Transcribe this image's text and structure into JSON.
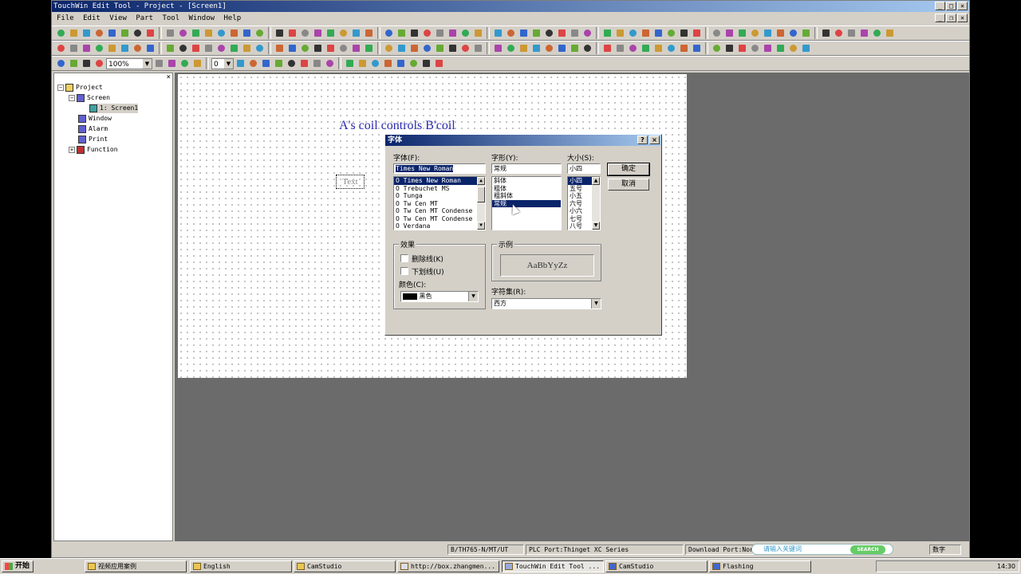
{
  "window": {
    "title": "TouchWin Edit Tool - Project - [Screen1]",
    "min": "_",
    "max": "□",
    "close": "×",
    "restore": "❐"
  },
  "menu": [
    "File",
    "Edit",
    "View",
    "Part",
    "Tool",
    "Window",
    "Help"
  ],
  "toolbar": {
    "zoom": "100%",
    "step": "0"
  },
  "tree": {
    "close": "×",
    "expand": "−",
    "collapse": "+",
    "project": "Project",
    "screen": "Screen",
    "screen1": "1: Screen1",
    "window": "Window",
    "alarm": "Alarm",
    "print": "Print",
    "function": "Function"
  },
  "canvas": {
    "title_text": "A's coil controls B'coil",
    "text_object": "Text"
  },
  "font_dialog": {
    "title": "字体",
    "help": "?",
    "close": "×",
    "font_label": "字体(F):",
    "font_value": "Times New Roman",
    "fonts": [
      "Times New Roman",
      "Trebuchet MS",
      "Tunga",
      "Tw Cen MT",
      "Tw Cen MT Condense",
      "Tw Cen MT Condense",
      "Verdana"
    ],
    "style_label": "字形(Y):",
    "style_value": "常规",
    "styles": [
      "常规",
      "斜体",
      "粗体",
      "粗斜体"
    ],
    "size_label": "大小(S):",
    "size_value": "小四",
    "sizes": [
      "小四",
      "五号",
      "小五",
      "六号",
      "小六",
      "七号",
      "八号"
    ],
    "ok": "确定",
    "cancel": "取消",
    "effects_label": "效果",
    "strikeout": "删除线(K)",
    "underline": "下划线(U)",
    "color_label": "颜色(C):",
    "color_value": "黑色",
    "sample_label": "示例",
    "sample_text": "AaBbYyZz",
    "charset_label": "字符集(R):",
    "charset_value": "西方"
  },
  "statusbar": {
    "model": "B/TH765-N/MT/UT",
    "plc_port": "PLC Port:Thinget XC Series",
    "download_port": "Download Port:Non",
    "search_placeholder": "请输入关键词",
    "search_button": "SEARCH",
    "ime": "数字"
  },
  "taskbar": {
    "start": "开始",
    "items": [
      "视频应用案例",
      "English",
      "CamStudio",
      "http://box.zhangmen...",
      "TouchWin Edit Tool ...",
      "CamStudio",
      "Flashing"
    ],
    "clock": "14:30"
  },
  "colors": {
    "titlebar_start": "#0a246a",
    "titlebar_end": "#a6caf0",
    "canvas_text": "#2b2bb0",
    "workspace": "#6b6b6b"
  }
}
